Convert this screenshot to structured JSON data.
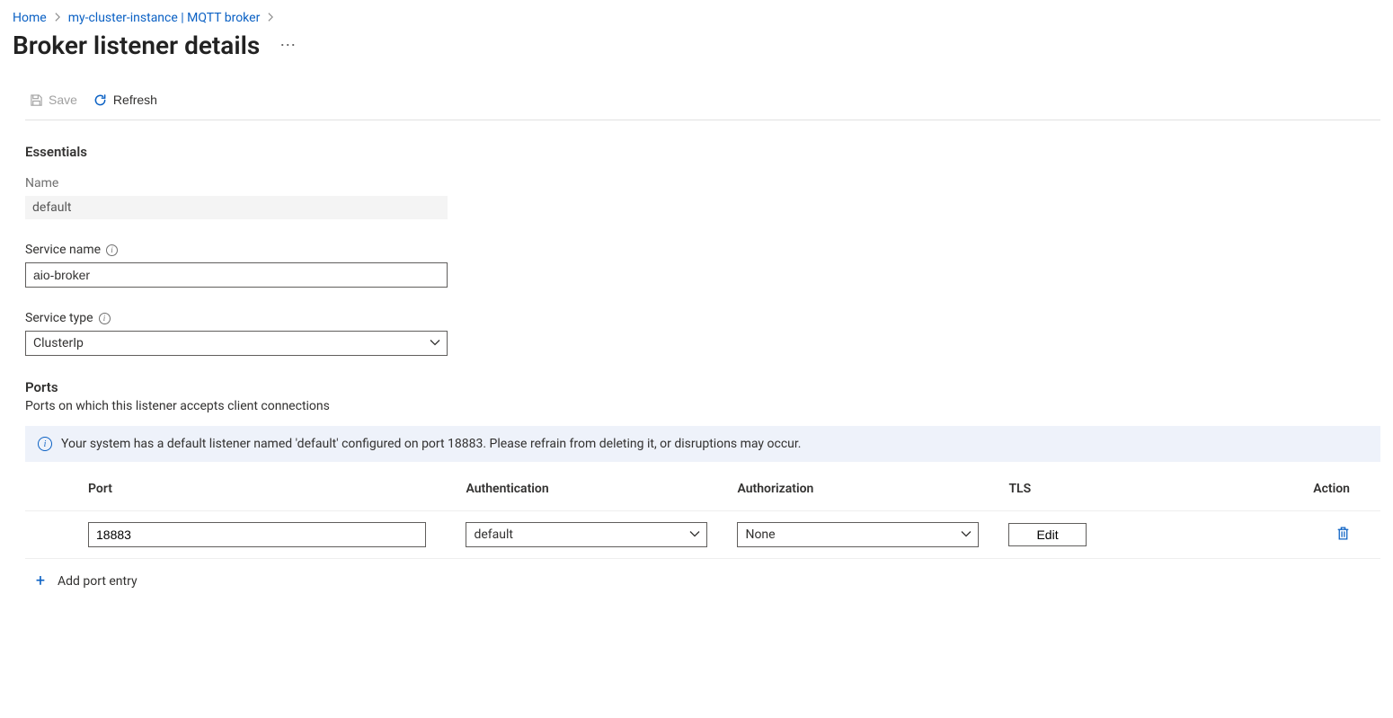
{
  "breadcrumb": {
    "home": "Home",
    "instance": "my-cluster-instance | MQTT broker"
  },
  "page": {
    "title": "Broker listener details"
  },
  "toolbar": {
    "save_label": "Save",
    "refresh_label": "Refresh"
  },
  "essentials": {
    "heading": "Essentials",
    "name_label": "Name",
    "name_value": "default",
    "service_name_label": "Service name",
    "service_name_value": "aio-broker",
    "service_type_label": "Service type",
    "service_type_value": "ClusterIp"
  },
  "ports": {
    "heading": "Ports",
    "description": "Ports on which this listener accepts client connections",
    "banner": "Your system has a default listener named 'default' configured on port 18883. Please refrain from deleting it, or disruptions may occur.",
    "columns": {
      "port": "Port",
      "authentication": "Authentication",
      "authorization": "Authorization",
      "tls": "TLS",
      "action": "Action"
    },
    "rows": [
      {
        "port": "18883",
        "authentication": "default",
        "authorization": "None",
        "tls_label": "Edit"
      }
    ],
    "add_label": "Add port entry"
  }
}
